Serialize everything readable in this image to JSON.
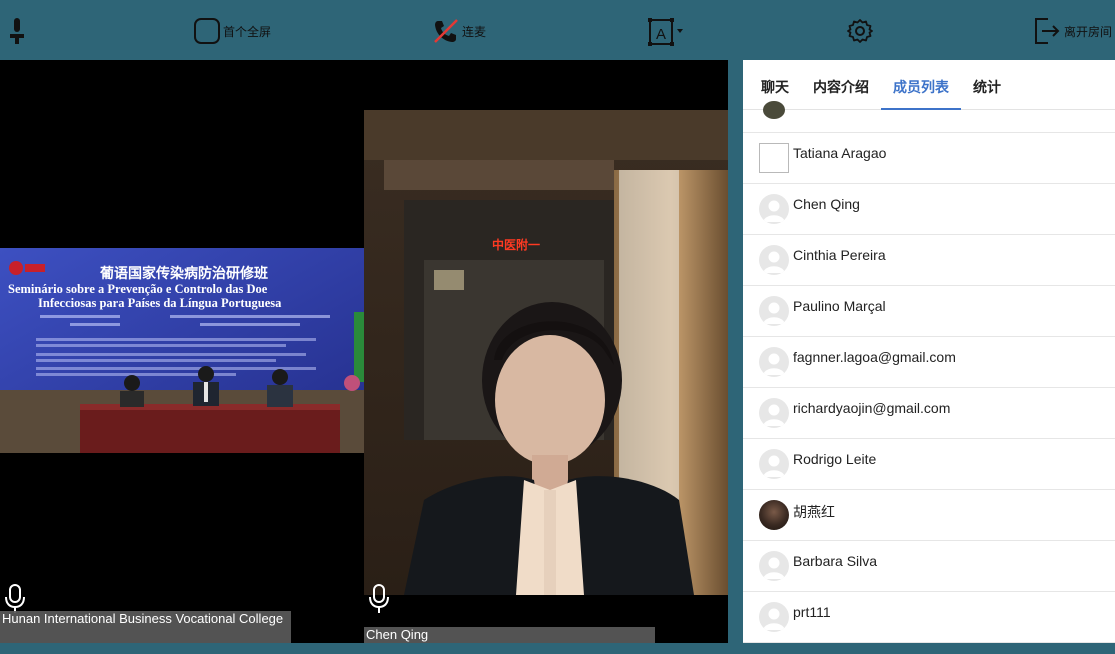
{
  "toolbar": {
    "fullscreen_label": "首个全屏",
    "connect_label": "连麦",
    "leave_label": "离开房间",
    "icons": {
      "person": "person-icon",
      "fullscreen": "square-icon",
      "connect": "phone-muted-icon",
      "layout": "text-layout-icon",
      "settings": "gear-icon",
      "leave": "exit-icon"
    }
  },
  "videos": [
    {
      "participant": "Hunan International Business Vocational College",
      "mic": "microphone-icon"
    },
    {
      "participant": "Chen Qing",
      "mic": "microphone-icon"
    }
  ],
  "slide": {
    "title_cn": "葡语国家传染病防治研修班",
    "title_pt_1": "Seminário sobre a Prevenção e Controlo das Doe",
    "title_pt_2": "Infecciosas para Países da Língua Portuguesa"
  },
  "scene_sign": "中医附一",
  "panel": {
    "tabs": [
      "聊天",
      "内容介绍",
      "成员列表",
      "统计"
    ],
    "active_tab": "成员列表",
    "members": [
      {
        "name": "Tatiana Aragao",
        "avatar": "broken-image"
      },
      {
        "name": "Chen Qing",
        "avatar": "default-avatar-icon"
      },
      {
        "name": "Cinthia Pereira",
        "avatar": "default-avatar-icon"
      },
      {
        "name": "Paulino Marçal",
        "avatar": "default-avatar-icon"
      },
      {
        "name": "fagnner.lagoa@gmail.com",
        "avatar": "default-avatar-icon"
      },
      {
        "name": "richardyaojin@gmail.com",
        "avatar": "default-avatar-icon"
      },
      {
        "name": "Rodrigo Leite",
        "avatar": "default-avatar-icon"
      },
      {
        "name": "胡燕红",
        "avatar": "photo"
      },
      {
        "name": "Barbara Silva",
        "avatar": "default-avatar-icon"
      },
      {
        "name": "prt111",
        "avatar": "default-avatar-icon"
      }
    ]
  },
  "colors": {
    "chrome": "#2e6577",
    "accent": "#3d73c9"
  }
}
